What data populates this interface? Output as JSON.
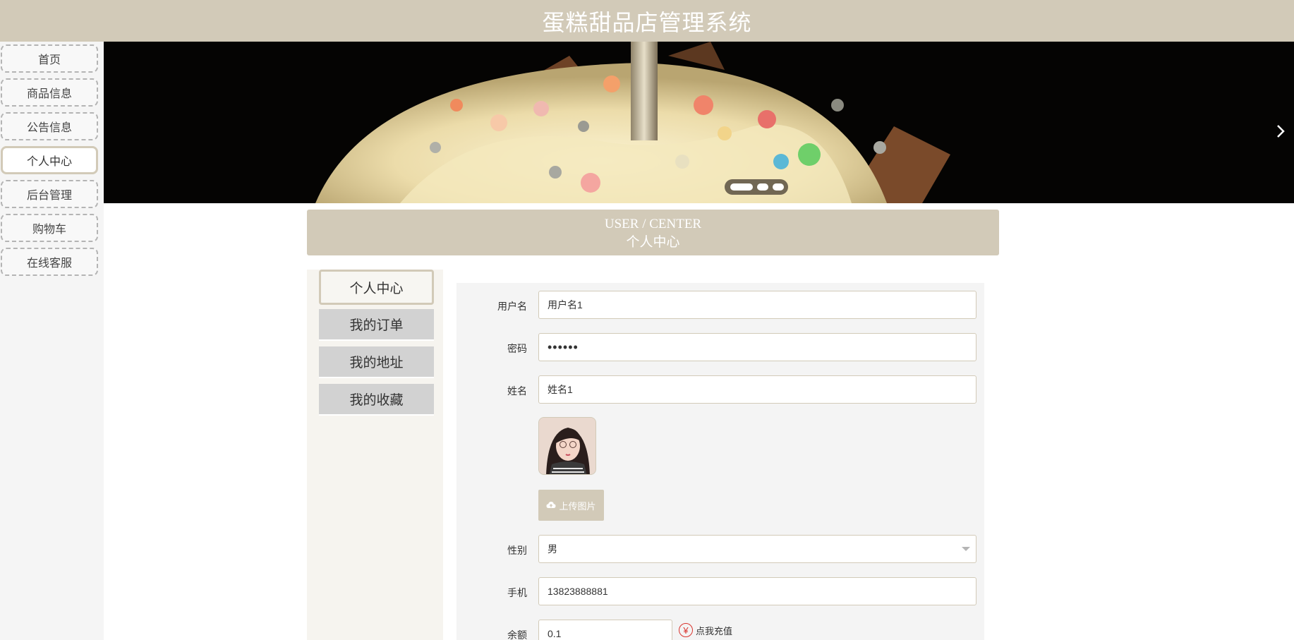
{
  "header": {
    "title": "蛋糕甜品店管理系统"
  },
  "sidebar": {
    "items": [
      {
        "label": "首页"
      },
      {
        "label": "商品信息"
      },
      {
        "label": "公告信息"
      },
      {
        "label": "个人中心",
        "active": true
      },
      {
        "label": "后台管理"
      },
      {
        "label": "购物车"
      },
      {
        "label": "在线客服"
      }
    ]
  },
  "banner": {
    "slide_count": 3,
    "active_slide": 1
  },
  "section": {
    "title_en": "USER / CENTER",
    "title_cn": "个人中心"
  },
  "user_menu": {
    "items": [
      {
        "label": "个人中心",
        "active": true
      },
      {
        "label": "我的订单"
      },
      {
        "label": "我的地址"
      },
      {
        "label": "我的收藏"
      }
    ]
  },
  "form": {
    "username": {
      "label": "用户名",
      "value": "用户名1"
    },
    "password": {
      "label": "密码",
      "value": "••••••"
    },
    "name": {
      "label": "姓名",
      "value": "姓名1"
    },
    "upload_label": "上传图片",
    "gender": {
      "label": "性别",
      "value": "男"
    },
    "phone": {
      "label": "手机",
      "value": "13823888881"
    },
    "balance": {
      "label": "余额",
      "value": "0.1"
    },
    "recharge_symbol": "¥",
    "recharge_label": "点我充值"
  },
  "colors": {
    "accent": "#d2cab8",
    "recharge": "#d9352f"
  }
}
